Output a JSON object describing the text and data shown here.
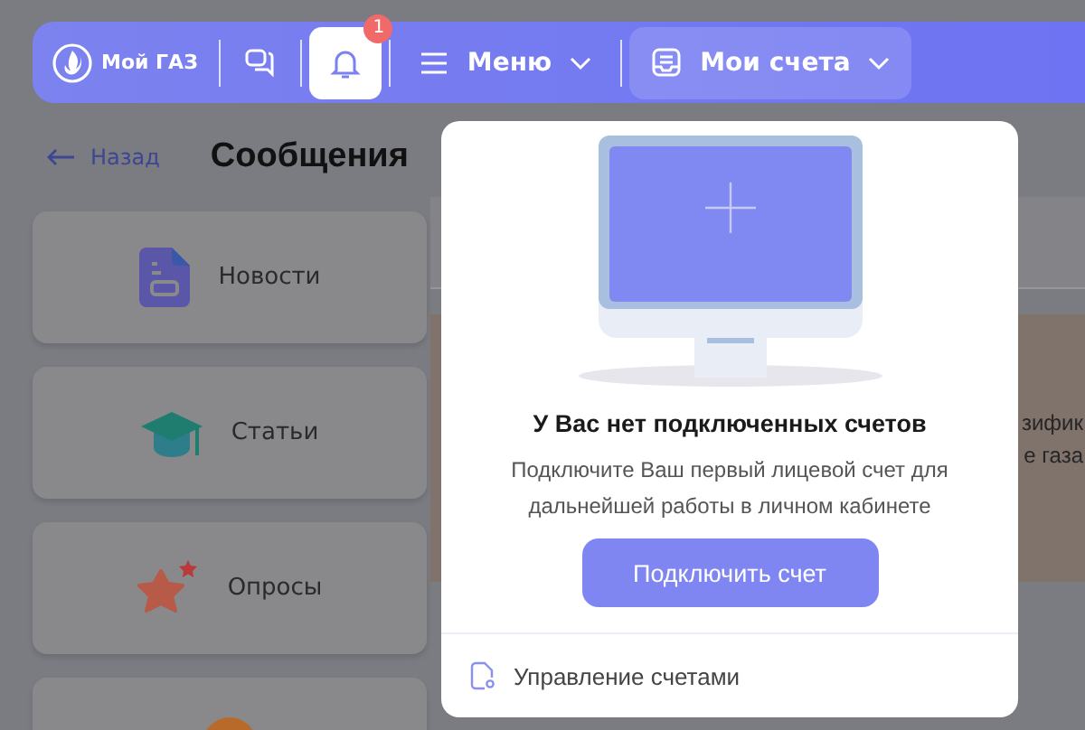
{
  "header": {
    "logo_text": "Мой ГАЗ",
    "items": [
      {
        "kind": "chat",
        "selected": false
      },
      {
        "kind": "bell",
        "selected": true,
        "badge": "1"
      },
      {
        "kind": "menu",
        "label": "Меню",
        "expanded": false
      },
      {
        "kind": "accounts",
        "label": "Мои счета",
        "expanded": true
      }
    ]
  },
  "back_link": "Назад",
  "page_title": "Сообщения",
  "categories": [
    {
      "kind": "news",
      "label": "Новости"
    },
    {
      "kind": "articles",
      "label": "Статьи"
    },
    {
      "kind": "polls",
      "label": "Опросы"
    },
    {
      "kind": "other"
    }
  ],
  "banner_fragments": [
    "зифик",
    "е газа"
  ],
  "popup": {
    "title": "У Вас нет подключенных счетов",
    "description": "Подключите Ваш первый лицевой счет для дальнейшей работы в личном кабинете",
    "button": "Подключить счет",
    "footer_link": "Управление счетами"
  }
}
